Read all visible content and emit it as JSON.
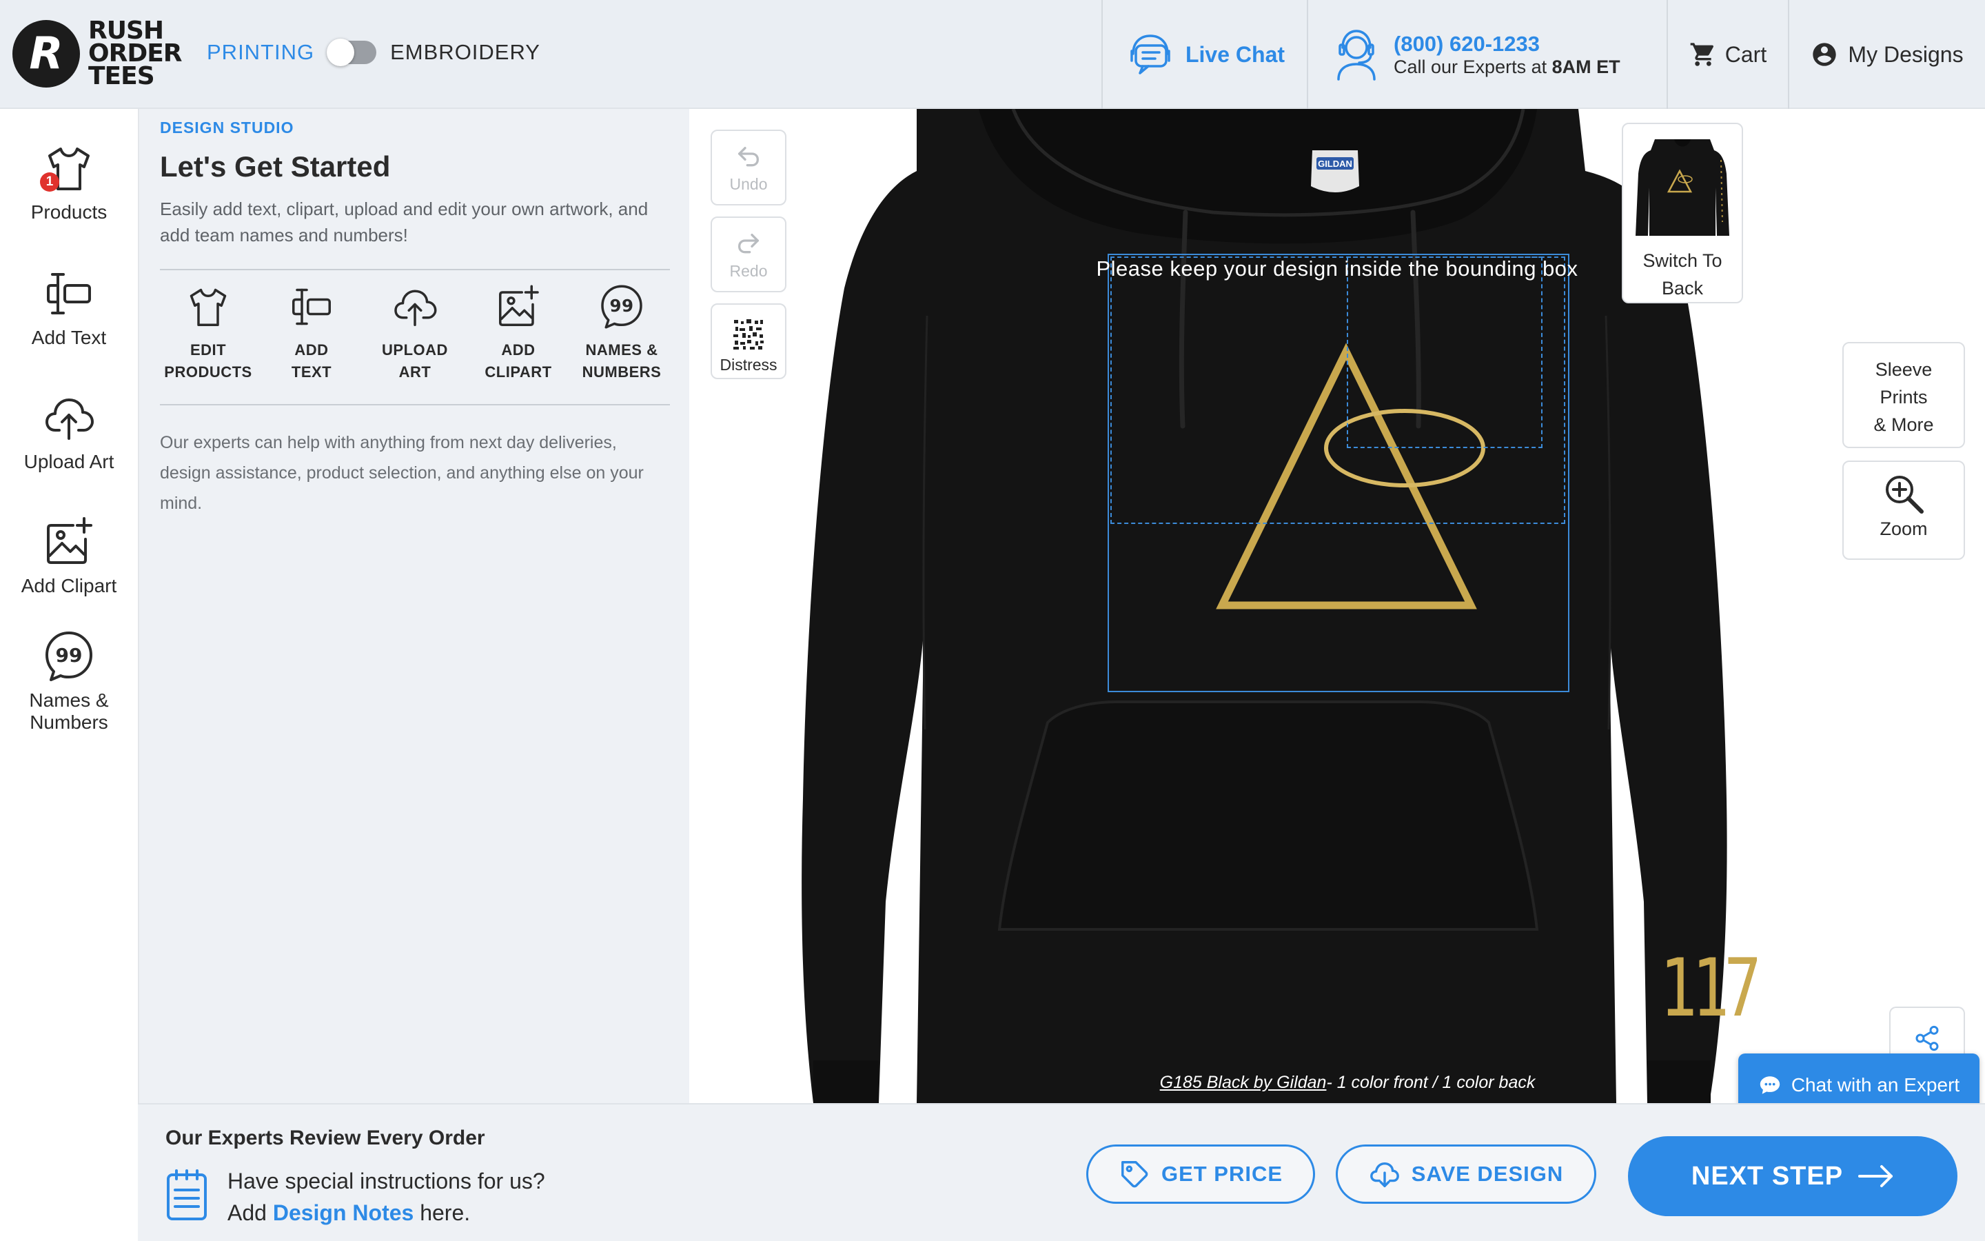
{
  "header": {
    "logo_lines": [
      "RUSH",
      "ORDER",
      "TEES"
    ],
    "mode_printing": "PRINTING",
    "mode_embroidery": "EMBROIDERY",
    "live_chat": "Live Chat",
    "phone_number": "(800) 620-1233",
    "phone_sub_prefix": "Call our Experts at ",
    "phone_sub_time": "8AM ET",
    "cart": "Cart",
    "my_designs": "My Designs"
  },
  "rail": {
    "products": "Products",
    "products_badge": "1",
    "add_text": "Add Text",
    "upload_art": "Upload Art",
    "add_clipart": "Add Clipart",
    "names_line1": "Names &",
    "names_line2": "Numbers"
  },
  "panel": {
    "label": "DESIGN STUDIO",
    "title": "Let's Get Started",
    "description": "Easily add text, clipart, upload and edit your own artwork, and add team names and numbers!",
    "tools": [
      {
        "line1": "EDIT",
        "line2": "PRODUCTS"
      },
      {
        "line1": "ADD",
        "line2": "TEXT"
      },
      {
        "line1": "UPLOAD",
        "line2": "ART"
      },
      {
        "line1": "ADD",
        "line2": "CLIPART"
      },
      {
        "line1": "NAMES &",
        "line2": "NUMBERS"
      }
    ],
    "help": "Our experts can help with anything from next day deliveries, design assistance, product selection, and anything else on your mind."
  },
  "canvas": {
    "undo": "Undo",
    "redo": "Redo",
    "distress": "Distress",
    "bbox_message": "Please keep your design inside the bounding box",
    "switch_line1": "Switch To",
    "switch_line2": "Back",
    "sleeve_line1": "Sleeve",
    "sleeve_line2": "Prints",
    "sleeve_line3": "& More",
    "zoom": "Zoom",
    "back_number": "117",
    "tag_text": "GILDAN",
    "caption_link": "G185 Black by Gildan",
    "caption_rest": "- 1 color front   /  1 color back",
    "chat_expert": "Chat with an Expert"
  },
  "bottom": {
    "title": "Our Experts Review Every Order",
    "line1": "Have special instructions for us?",
    "line2_prefix": "Add ",
    "line2_link": "Design Notes",
    "line2_suffix": " here.",
    "get_price": "GET PRICE",
    "save_design": "SAVE DESIGN",
    "next_step": "NEXT STEP"
  },
  "colors": {
    "accent": "#2d8ae6",
    "garment": "#141414",
    "gold": "#c9a84e",
    "badge": "#e0322d"
  }
}
